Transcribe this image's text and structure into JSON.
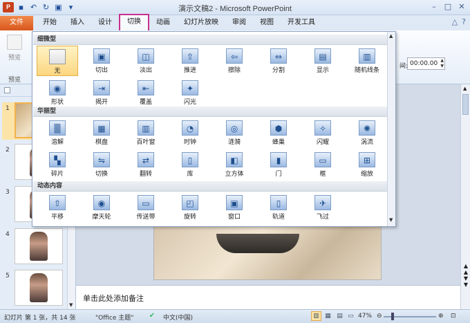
{
  "window": {
    "title": "演示文稿2 - Microsoft PowerPoint",
    "app_icon_letter": "P",
    "controls": [
      "minimize-icon",
      "maximize-icon",
      "close-icon"
    ]
  },
  "qat": {
    "items": [
      "save-icon",
      "undo-icon",
      "redo-icon",
      "slideshow-icon",
      "customize-icon"
    ]
  },
  "tabs": [
    {
      "label": "文件"
    },
    {
      "label": "开始"
    },
    {
      "label": "插入"
    },
    {
      "label": "设计"
    },
    {
      "label": "切换",
      "active": true
    },
    {
      "label": "动画"
    },
    {
      "label": "幻灯片放映"
    },
    {
      "label": "审阅"
    },
    {
      "label": "视图"
    },
    {
      "label": "开发工具"
    }
  ],
  "ribbon": {
    "preview_label": "预览",
    "group_label": "预览",
    "duration_label": "间:",
    "duration_value": "00:00.00"
  },
  "gallery": {
    "sections": [
      {
        "title": "细微型",
        "items": [
          "无",
          "切出",
          "淡出",
          "推进",
          "擦除",
          "分割",
          "显示",
          "随机线条",
          "形状",
          "揭开",
          "覆盖",
          "闪光"
        ]
      },
      {
        "title": "华丽型",
        "items": [
          "溶解",
          "棋盘",
          "百叶窗",
          "时钟",
          "涟漪",
          "蜂巢",
          "闪耀",
          "涡流",
          "碎片",
          "切换",
          "翻转",
          "库",
          "立方体",
          "门",
          "框",
          "缩放"
        ]
      },
      {
        "title": "动态内容",
        "items": [
          "平移",
          "摩天轮",
          "传送带",
          "旋转",
          "窗口",
          "轨道",
          "飞过"
        ]
      }
    ],
    "selected": "无"
  },
  "slides": {
    "numbers": [
      "1",
      "2",
      "3",
      "4",
      "5"
    ]
  },
  "notes": {
    "placeholder": "单击此处添加备注"
  },
  "status": {
    "slide_info": "幻灯片 第 1 张，共 14 张",
    "theme": "\"Office 主题\"",
    "language": "中文(中国)",
    "zoom": "47%"
  }
}
